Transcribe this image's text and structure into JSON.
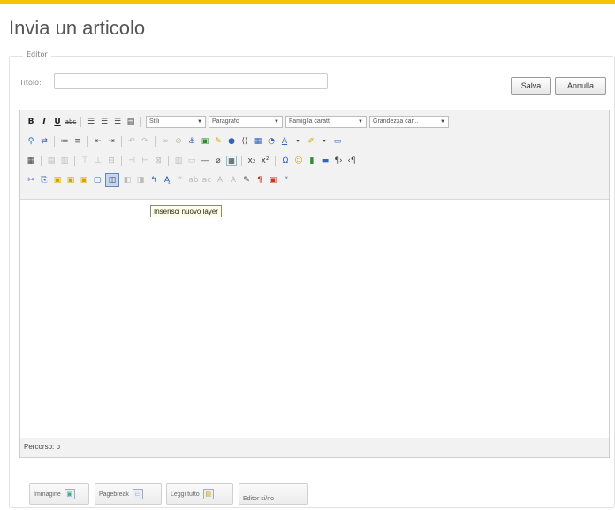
{
  "page": {
    "title": "Invia un articolo",
    "accent": "#f5c400"
  },
  "editor": {
    "legend": "Editor",
    "title_label": "Titolo:",
    "title_value": "",
    "save_label": "Salva",
    "cancel_label": "Annulla",
    "toolbar": {
      "row1": {
        "style_select": "Stili",
        "format_select": "Paragrafo",
        "font_select": "Famiglia caratt",
        "size_select": "Grandezza car..."
      }
    },
    "tooltip": "Inserisci nuovo layer",
    "status_path": "Percorso: p"
  },
  "xtd_buttons": [
    {
      "label": "Immagine",
      "icon": "image-icon"
    },
    {
      "label": "Pagebreak",
      "icon": "pagebreak-icon"
    },
    {
      "label": "Leggi tutto",
      "icon": "readmore-icon"
    },
    {
      "label": "Editor si/no",
      "icon": ""
    }
  ]
}
